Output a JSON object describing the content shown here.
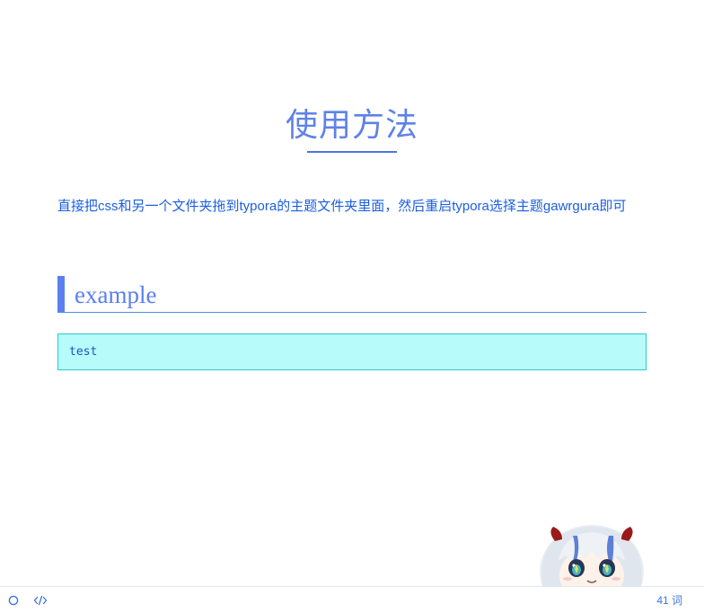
{
  "document": {
    "title": "使用方法",
    "paragraph": "直接把css和另一个文件夹拖到typora的主题文件夹里面，然后重启typora选择主题gawrgura即可",
    "heading2": "example",
    "code_block": "test"
  },
  "statusbar": {
    "outline_icon": "circle-icon",
    "source_icon": "code-icon",
    "word_count": "41 词"
  },
  "colors": {
    "accent": "#5a7ff0",
    "text_blue": "#1c5fe0",
    "code_bg": "#b8fbfb",
    "code_border": "#2ec9c9"
  }
}
